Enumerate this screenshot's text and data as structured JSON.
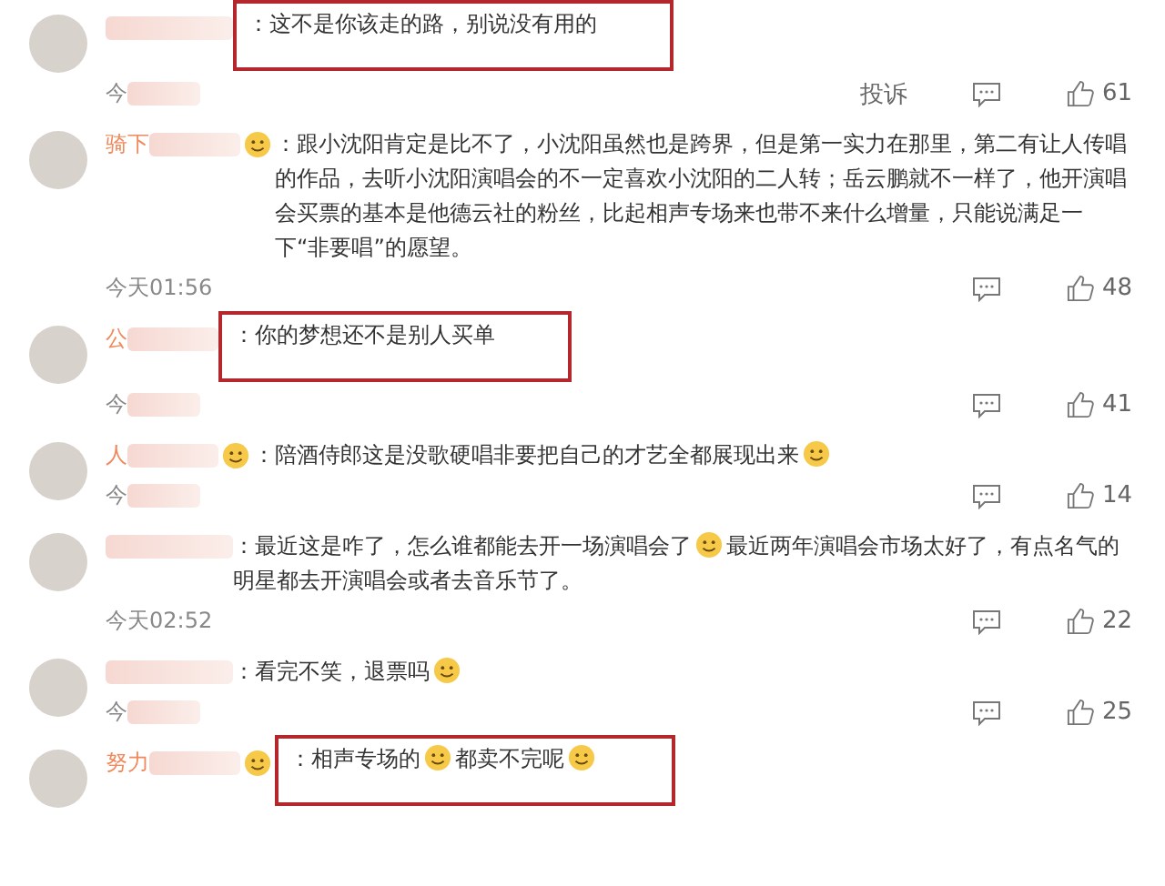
{
  "comments": [
    {
      "badge": false,
      "highlighted": true,
      "separator": "：",
      "segments": [
        "这不是你该走的路，别说没有用的"
      ],
      "trailing_emoji": false,
      "time": "今",
      "time_blurred": true,
      "report": "投诉",
      "likes": "61"
    },
    {
      "name": "骑下",
      "badge": true,
      "highlighted": false,
      "separator": "：",
      "segments": [
        "跟小沈阳肯定是比不了，小沈阳虽然也是跨界，但是第一实力在那里，第二有让人传唱的作品，去听小沈阳演唱会的不一定喜欢小沈阳的二人转；岳云鹏就不一样了，他开演唱会买票的基本是他德云社的粉丝，比起相声专场来也带不来什么增量，只能说满足一下“非要唱”的愿望。"
      ],
      "trailing_emoji": false,
      "time": "今天01:56",
      "time_blurred": false,
      "likes": "48"
    },
    {
      "name": "公",
      "badge": false,
      "highlighted": true,
      "separator": "：",
      "segments": [
        "你的梦想还不是别人买单"
      ],
      "trailing_emoji": false,
      "time": "今",
      "time_blurred": true,
      "likes": "41"
    },
    {
      "name": "人",
      "badge": true,
      "highlighted": false,
      "separator": "：",
      "segments": [
        "陪酒侍郎这是没歌硬唱非要把自己的才艺全都展现出来"
      ],
      "trailing_emoji": true,
      "time": "今",
      "time_blurred": true,
      "likes": "14"
    },
    {
      "badge": false,
      "highlighted": false,
      "separator": "：",
      "segments": [
        "最近这是咋了，怎么谁都能去开一场演唱会了",
        "最近两年演唱会市场太好了，有点名气的明星都去开演唱会或者去音乐节了。"
      ],
      "trailing_emoji": false,
      "time": "今天02:52",
      "time_blurred": false,
      "likes": "22"
    },
    {
      "badge": false,
      "highlighted": false,
      "separator": "：",
      "segments": [
        "看完不笑，退票吗"
      ],
      "trailing_emoji": true,
      "time": "今",
      "time_blurred": true,
      "likes": "25"
    },
    {
      "name": "努力",
      "badge": true,
      "highlighted": true,
      "separator": "：",
      "segments": [
        "相声专场的",
        "都卖不完呢"
      ],
      "trailing_emoji": true
    }
  ]
}
